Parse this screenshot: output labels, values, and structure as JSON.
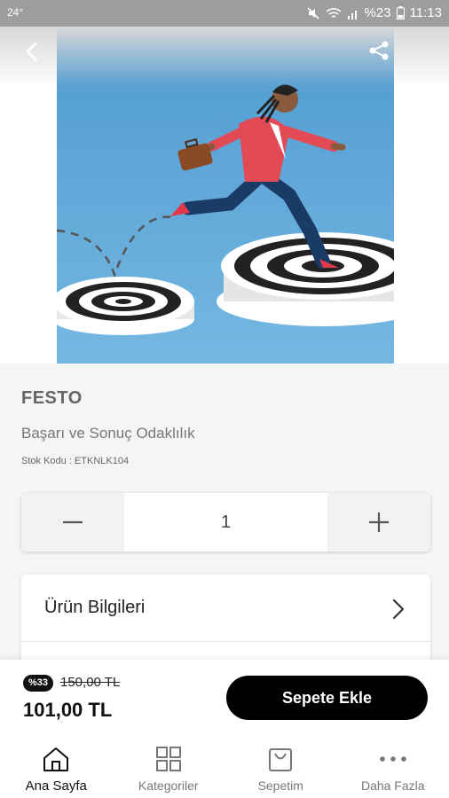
{
  "status_bar": {
    "temperature": "24°",
    "battery": "%23",
    "time": "11:13"
  },
  "hero": {
    "back_icon": "chevron-left-icon",
    "share_icon": "share-icon"
  },
  "product": {
    "brand": "FESTO",
    "name": "Başarı ve Sonuç Odaklılık",
    "stock_code": "Stok Kodu : ETKNLK104"
  },
  "stepper": {
    "minus_icon": "minus-icon",
    "quantity": "1",
    "plus_icon": "plus-icon"
  },
  "info": {
    "product_info_label": "Ürün Bilgileri"
  },
  "cart": {
    "discount_badge": "%33",
    "old_price": "150,00 TL",
    "new_price": "101,00 TL",
    "add_to_cart_label": "Sepete Ekle"
  },
  "bottom_nav": {
    "items": [
      {
        "label": "Ana Sayfa",
        "icon": "home-icon",
        "active": true
      },
      {
        "label": "Kategoriler",
        "icon": "grid-icon",
        "active": false
      },
      {
        "label": "Sepetim",
        "icon": "bag-icon",
        "active": false
      },
      {
        "label": "Daha Fazla",
        "icon": "more-icon",
        "active": false
      }
    ]
  },
  "colors": {
    "accent": "#000000",
    "status_bar": "#9e9e9e",
    "illustration_bg": "#5aa6d6",
    "stepper_button_bg": "#f1f3f3"
  }
}
